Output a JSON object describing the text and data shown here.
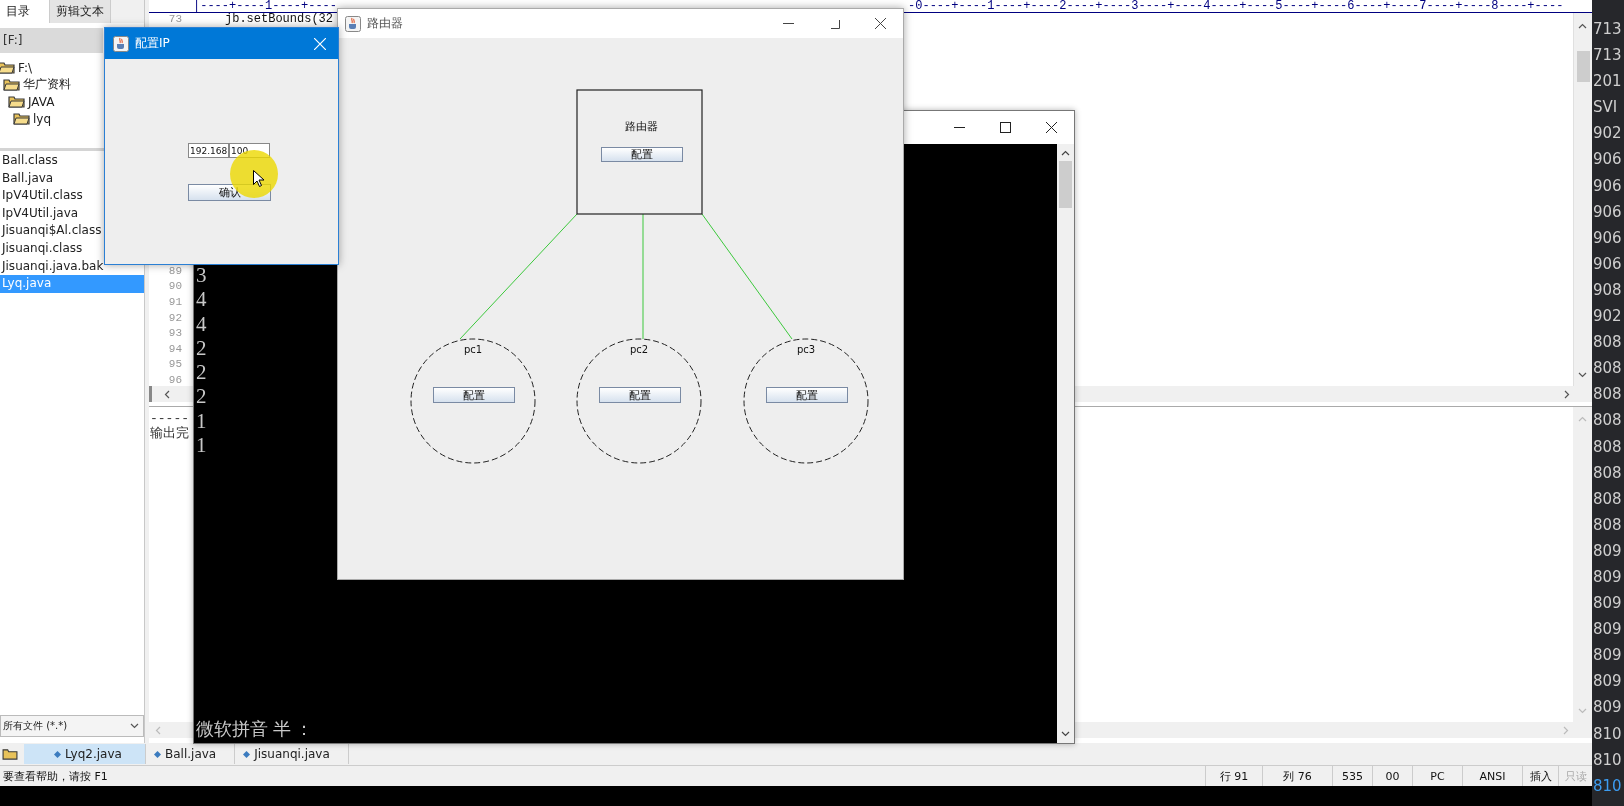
{
  "editor": {
    "panel_tabs": [
      {
        "label": "目录",
        "selected": true
      },
      {
        "label": "剪辑文本",
        "selected": false
      }
    ],
    "drive": "[F:]",
    "tree": [
      {
        "label": "F:\\",
        "children": [
          {
            "label": "华广资料",
            "children": [
              {
                "label": "JAVA",
                "children": [
                  {
                    "label": "lyq"
                  }
                ]
              }
            ]
          }
        ]
      }
    ],
    "files": [
      {
        "name": "Ball.class",
        "selected": false
      },
      {
        "name": "Ball.java",
        "selected": false
      },
      {
        "name": "IpV4Util.class",
        "selected": false
      },
      {
        "name": "IpV4Util.java",
        "selected": false
      },
      {
        "name": "Jisuanqi$Al.class",
        "selected": false
      },
      {
        "name": "Jisuanqi.class",
        "selected": false
      },
      {
        "name": "Jisuanqi.java.bak",
        "selected": false
      },
      {
        "name": "Lyq.java",
        "selected": true
      }
    ],
    "file_filter": "所有文件 (*.*)",
    "ruler": [
      "|----+----1----+----",
      "-0----+----1----+----2----+----3----+----4----+----5----+----6----+----7----+----8----+----"
    ],
    "code_lines": [
      {
        "number": "73",
        "text": "jb.setBounds(32"
      }
    ],
    "line_numbers": [
      "89",
      "90",
      "91",
      "92",
      "93",
      "94",
      "95",
      "96"
    ],
    "output_lines": [
      "-----",
      "输出完"
    ],
    "doc_tabs": [
      {
        "label": "Lyq2.java",
        "selected": true
      },
      {
        "label": "Ball.java",
        "selected": false
      },
      {
        "label": "Jisuanqi.java",
        "selected": false
      }
    ],
    "status_bar": {
      "help": "要查看帮助，请按 F1",
      "cells": [
        {
          "text": "行 91",
          "disabled": false
        },
        {
          "text": "列 76",
          "disabled": false
        },
        {
          "text": "535",
          "disabled": false
        },
        {
          "text": "00",
          "disabled": false
        },
        {
          "text": "PC",
          "disabled": false
        },
        {
          "text": "ANSI",
          "disabled": false
        },
        {
          "text": "插入",
          "disabled": false
        },
        {
          "text": "只读",
          "disabled": true
        }
      ]
    }
  },
  "side_list": [
    {
      "text": "713",
      "selected": false
    },
    {
      "text": "713",
      "selected": false
    },
    {
      "text": "201",
      "selected": false
    },
    {
      "text": "SVI",
      "selected": false
    },
    {
      "text": "902",
      "selected": false
    },
    {
      "text": "906",
      "selected": false
    },
    {
      "text": "906",
      "selected": false
    },
    {
      "text": "906",
      "selected": false
    },
    {
      "text": "906",
      "selected": false
    },
    {
      "text": "906",
      "selected": false
    },
    {
      "text": "908",
      "selected": false
    },
    {
      "text": "902",
      "selected": false
    },
    {
      "text": "808",
      "selected": false
    },
    {
      "text": "808",
      "selected": false
    },
    {
      "text": "808",
      "selected": false
    },
    {
      "text": "808",
      "selected": false
    },
    {
      "text": "808",
      "selected": false
    },
    {
      "text": "808",
      "selected": false
    },
    {
      "text": "808",
      "selected": false
    },
    {
      "text": "808",
      "selected": false
    },
    {
      "text": "809",
      "selected": false
    },
    {
      "text": "809",
      "selected": false
    },
    {
      "text": "809",
      "selected": false
    },
    {
      "text": "809",
      "selected": false
    },
    {
      "text": "809",
      "selected": false
    },
    {
      "text": "809",
      "selected": false
    },
    {
      "text": "809",
      "selected": false
    },
    {
      "text": "810",
      "selected": false
    },
    {
      "text": "810",
      "selected": false
    },
    {
      "text": "810",
      "selected": true
    }
  ],
  "console_window": {
    "lines": [
      "3",
      "4",
      "4",
      "2",
      "2",
      "2",
      "1",
      "1"
    ],
    "ime_status": "微软拼音 半 ："
  },
  "router_window": {
    "title": "路由器",
    "router": {
      "label": "路由器",
      "button": "配置"
    },
    "pcs": [
      {
        "label": "pc1",
        "button": "配置"
      },
      {
        "label": "pc2",
        "button": "配置"
      },
      {
        "label": "pc3",
        "button": "配置"
      }
    ]
  },
  "config_window": {
    "title": "配置IP",
    "fields": [
      {
        "value": "192.168"
      },
      {
        "value": "100"
      }
    ],
    "button": "确认"
  }
}
